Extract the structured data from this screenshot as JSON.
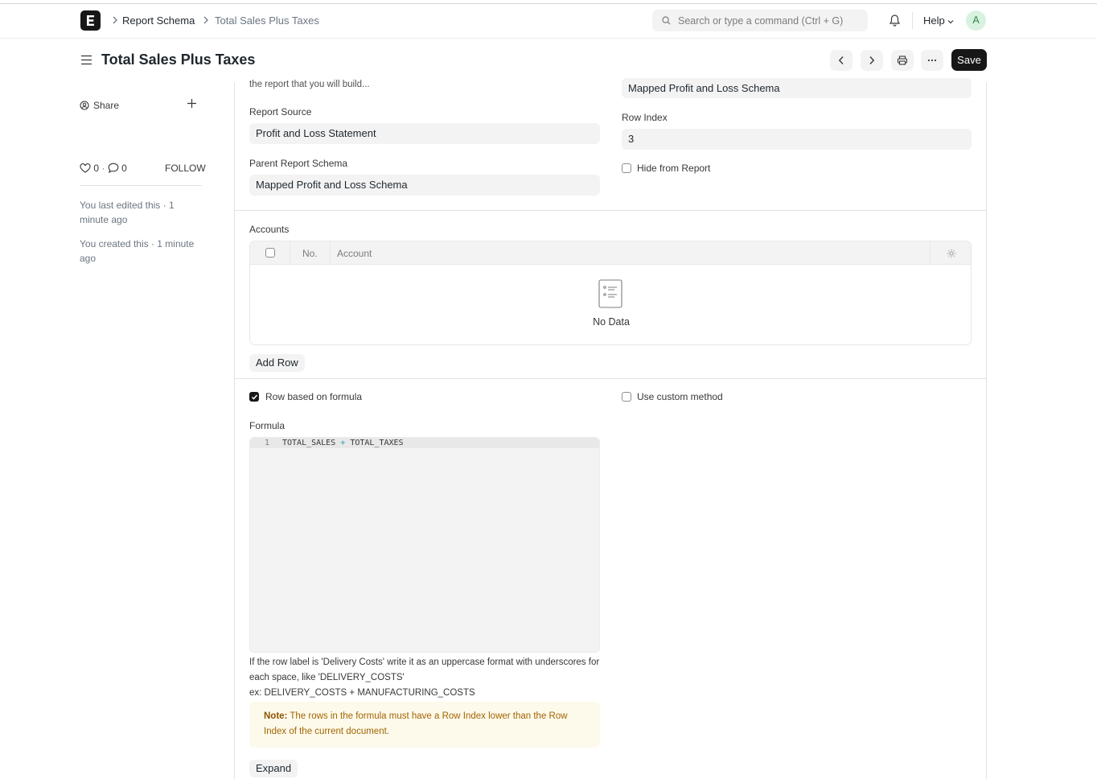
{
  "navbar": {
    "breadcrumbs": [
      "Report Schema",
      "Total Sales Plus Taxes"
    ],
    "search_placeholder": "Search or type a command (Ctrl + G)",
    "help_label": "Help",
    "avatar_initial": "A"
  },
  "page": {
    "title": "Total Sales Plus Taxes",
    "save_label": "Save"
  },
  "sidebar": {
    "share_label": "Share",
    "likes_count": "0",
    "comments_count": "0",
    "follow_label": "FOLLOW",
    "last_edited": "You last edited this · 1 minute ago",
    "created": "You created this · 1 minute ago"
  },
  "form": {
    "top_truncated_text": "the report that you will build...",
    "report_source_label": "Report Source",
    "report_source_value": "Profit and Loss Statement",
    "parent_schema_label": "Parent Report Schema",
    "parent_schema_value": "Mapped Profit and Loss Schema",
    "right_top_value": "Mapped Profit and Loss Schema",
    "row_index_label": "Row Index",
    "row_index_value": "3",
    "hide_from_report_label": "Hide from Report",
    "accounts_label": "Accounts",
    "accounts_columns": [
      "No.",
      "Account"
    ],
    "no_data_label": "No Data",
    "add_row_label": "Add Row",
    "row_based_on_formula_label": "Row based on formula",
    "row_based_on_formula_checked": true,
    "use_custom_method_label": "Use custom method",
    "formula_label": "Formula",
    "formula_line_number": "1",
    "formula_tokens": [
      "TOTAL_SALES",
      "+",
      "TOTAL_TAXES"
    ],
    "help_line1": "If the row label is 'Delivery Costs' write it as an uppercase format with underscores for each space, like 'DELIVERY_COSTS'",
    "help_line2": "ex: DELIVERY_COSTS + MANUFACTURING_COSTS",
    "note_label": "Note:",
    "note_text": "The rows in the formula must have a Row Index lower than the Row Index of the current document.",
    "expand_label": "Expand"
  },
  "colors": {
    "primary_dark": "#171717",
    "control_bg": "#f3f3f3",
    "note_bg": "#fefaeb",
    "note_text": "#a16402",
    "avatar_bg": "#d8f2df"
  }
}
